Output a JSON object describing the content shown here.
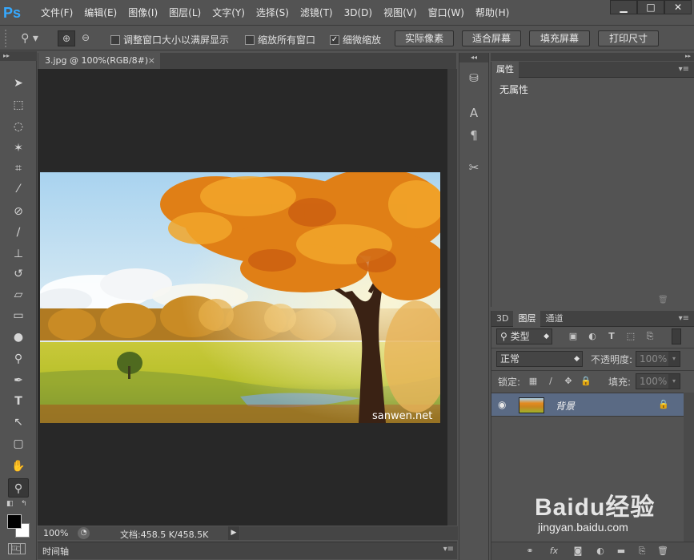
{
  "app": {
    "logo": "Ps"
  },
  "menu": [
    "文件(F)",
    "编辑(E)",
    "图像(I)",
    "图层(L)",
    "文字(Y)",
    "选择(S)",
    "滤镜(T)",
    "3D(D)",
    "视图(V)",
    "窗口(W)",
    "帮助(H)"
  ],
  "window_controls": {
    "minimize": "▁",
    "maximize": "□",
    "close": "✕"
  },
  "options": {
    "resize_windows_label": "调整窗口大小以满屏显示",
    "zoom_all_label": "缩放所有窗口",
    "scrubby_zoom_label": "细微缩放",
    "scrubby_zoom_checked": "✓",
    "buttons": [
      "实际像素",
      "适合屏幕",
      "填充屏幕",
      "打印尺寸"
    ]
  },
  "document": {
    "tab_title": "3.jpg @ 100%(RGB/8#)",
    "tab_close": "×",
    "zoom": "100%",
    "doc_size": "文档:458.5 K/458.5K",
    "watermark": "sanwen.net"
  },
  "timeline": {
    "label": "时间轴"
  },
  "properties": {
    "tab": "属性",
    "no_props": "无属性"
  },
  "layers": {
    "tabs": [
      "3D",
      "图层",
      "通道"
    ],
    "filter_kind": "类型",
    "blend_mode": "正常",
    "opacity_label": "不透明度:",
    "opacity_value": "100%",
    "lock_label": "锁定:",
    "fill_label": "填充:",
    "fill_value": "100%",
    "layer_name": "背景"
  },
  "colors": {
    "accent": "#36a9ff",
    "selected_layer": "#5a6a84",
    "workspace": "#282828",
    "panel": "#535353"
  },
  "icons": [
    "search-icon",
    "zoom-in-icon",
    "zoom-out-icon",
    "move-icon",
    "marquee-icon",
    "lasso-icon",
    "magic-wand-icon",
    "crop-icon",
    "eyedropper-icon",
    "healing-icon",
    "brush-icon",
    "stamp-icon",
    "history-brush-icon",
    "eraser-icon",
    "gradient-icon",
    "blur-icon",
    "dodge-icon",
    "pen-icon",
    "type-icon",
    "path-select-icon",
    "rectangle-icon",
    "hand-icon",
    "zoom-icon",
    "eye-icon",
    "lock-icon"
  ],
  "watermark_site": {
    "brand": "Baidu经验",
    "url": "jingyan.baidu.com"
  }
}
